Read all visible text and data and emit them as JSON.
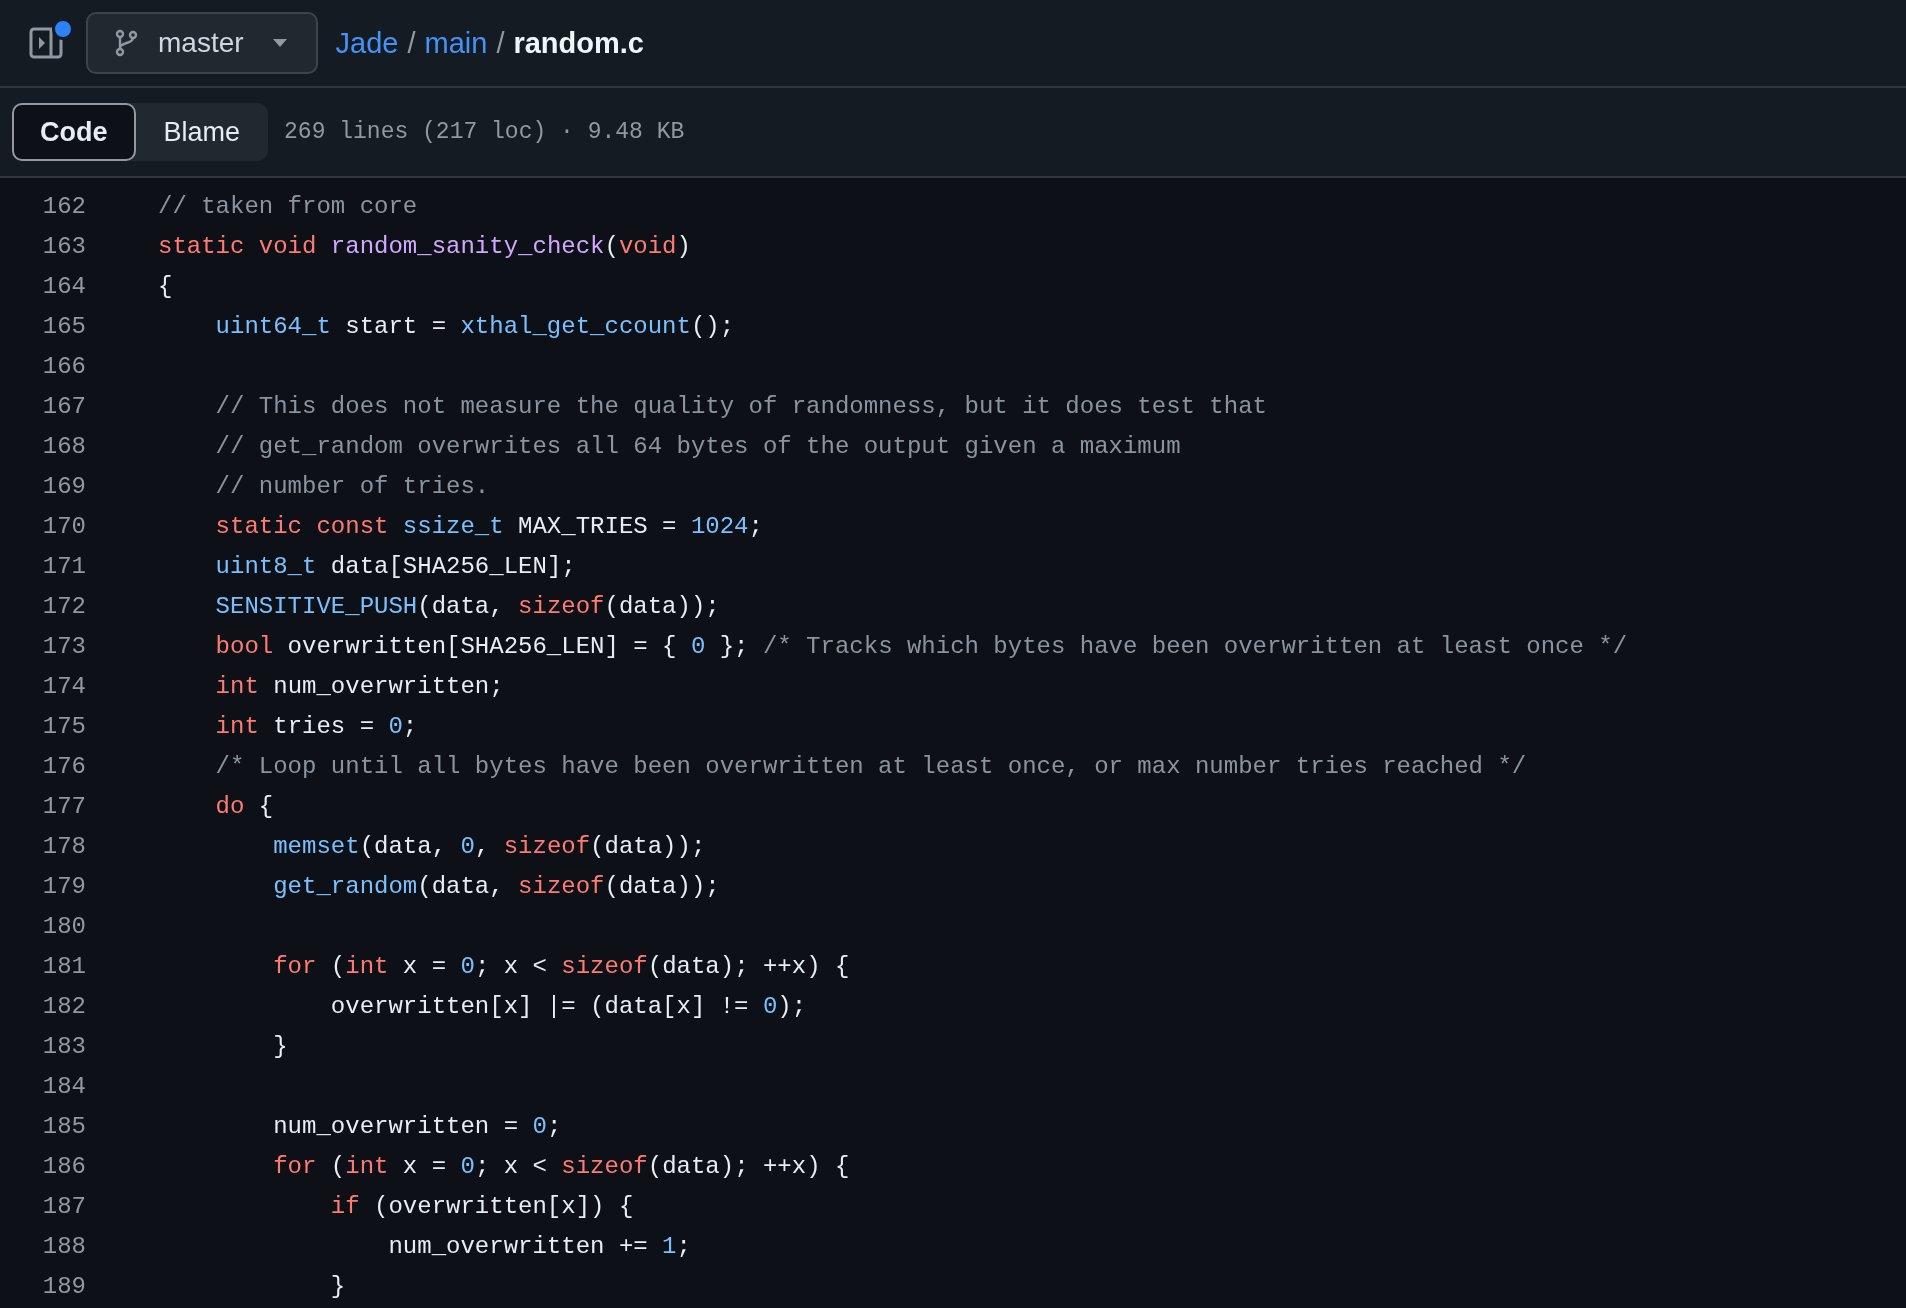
{
  "header": {
    "notification_dot": true,
    "branch": "master",
    "breadcrumb": [
      {
        "text": "Jade",
        "kind": "link"
      },
      {
        "text": "/",
        "kind": "sep"
      },
      {
        "text": "main",
        "kind": "link"
      },
      {
        "text": "/",
        "kind": "sep"
      },
      {
        "text": "random.c",
        "kind": "current"
      }
    ]
  },
  "tabs": [
    {
      "label": "Code",
      "selected": true
    },
    {
      "label": "Blame",
      "selected": false
    }
  ],
  "file_info": "269 lines (217 loc) · 9.48 KB",
  "lines": [
    {
      "number": "162",
      "tokens": [
        {
          "kind": "c",
          "text": "// taken from core"
        }
      ]
    },
    {
      "number": "163",
      "tokens": [
        {
          "kind": "k",
          "text": "static void"
        },
        {
          "kind": "f",
          "text": " random_sanity_check"
        },
        {
          "kind": "p",
          "text": "("
        },
        {
          "kind": "k",
          "text": "void"
        },
        {
          "kind": "p",
          "text": ")"
        }
      ]
    },
    {
      "number": "164",
      "tokens": [
        {
          "kind": "p",
          "text": "{"
        }
      ]
    },
    {
      "number": "165",
      "tokens": [
        {
          "kind": "t",
          "text": "    uint64_t"
        },
        {
          "kind": "p",
          "text": " start = "
        },
        {
          "kind": "t",
          "text": "xthal_get_ccount"
        },
        {
          "kind": "p",
          "text": "();"
        }
      ]
    },
    {
      "number": "166"
    },
    {
      "number": "167",
      "tokens": [
        {
          "kind": "c",
          "text": "    // This does not measure the quality of randomness, but it does test that"
        }
      ]
    },
    {
      "number": "168",
      "tokens": [
        {
          "kind": "c",
          "text": "    // get_random overwrites all 64 bytes of the output given a maximum"
        }
      ]
    },
    {
      "number": "169",
      "tokens": [
        {
          "kind": "c",
          "text": "    // number of tries."
        }
      ]
    },
    {
      "number": "170",
      "tokens": [
        {
          "kind": "k",
          "text": "    static const"
        },
        {
          "kind": "t",
          "text": " ssize_t"
        },
        {
          "kind": "p",
          "text": " MAX_TRIES = "
        },
        {
          "kind": "n",
          "text": "1024"
        },
        {
          "kind": "p",
          "text": ";"
        }
      ]
    },
    {
      "number": "171",
      "tokens": [
        {
          "kind": "t",
          "text": "    uint8_t"
        },
        {
          "kind": "p",
          "text": " data[SHA256_LEN];"
        }
      ]
    },
    {
      "number": "172",
      "tokens": [
        {
          "kind": "t",
          "text": "    SENSITIVE_PUSH"
        },
        {
          "kind": "p",
          "text": "(data, "
        },
        {
          "kind": "k",
          "text": "sizeof"
        },
        {
          "kind": "p",
          "text": "(data));"
        }
      ]
    },
    {
      "number": "173",
      "tokens": [
        {
          "kind": "k",
          "text": "    bool"
        },
        {
          "kind": "p",
          "text": " overwritten[SHA256_LEN] = { "
        },
        {
          "kind": "n",
          "text": "0"
        },
        {
          "kind": "p",
          "text": " }; "
        },
        {
          "kind": "c",
          "text": "/* Tracks which bytes have been overwritten at least once */"
        }
      ]
    },
    {
      "number": "174",
      "tokens": [
        {
          "kind": "k",
          "text": "    int"
        },
        {
          "kind": "p",
          "text": " num_overwritten;"
        }
      ]
    },
    {
      "number": "175",
      "tokens": [
        {
          "kind": "k",
          "text": "    int"
        },
        {
          "kind": "p",
          "text": " tries = "
        },
        {
          "kind": "n",
          "text": "0"
        },
        {
          "kind": "p",
          "text": ";"
        }
      ]
    },
    {
      "number": "176",
      "tokens": [
        {
          "kind": "c",
          "text": "    /* Loop until all bytes have been overwritten at least once, or max number tries reached */"
        }
      ]
    },
    {
      "number": "177",
      "tokens": [
        {
          "kind": "k",
          "text": "    do"
        },
        {
          "kind": "p",
          "text": " {"
        }
      ]
    },
    {
      "number": "178",
      "tokens": [
        {
          "kind": "t",
          "text": "        memset"
        },
        {
          "kind": "p",
          "text": "(data, "
        },
        {
          "kind": "n",
          "text": "0"
        },
        {
          "kind": "p",
          "text": ", "
        },
        {
          "kind": "k",
          "text": "sizeof"
        },
        {
          "kind": "p",
          "text": "(data));"
        }
      ]
    },
    {
      "number": "179",
      "tokens": [
        {
          "kind": "t",
          "text": "        get_random"
        },
        {
          "kind": "p",
          "text": "(data, "
        },
        {
          "kind": "k",
          "text": "sizeof"
        },
        {
          "kind": "p",
          "text": "(data));"
        }
      ]
    },
    {
      "number": "180"
    },
    {
      "number": "181",
      "tokens": [
        {
          "kind": "k",
          "text": "        for"
        },
        {
          "kind": "p",
          "text": " ("
        },
        {
          "kind": "k",
          "text": "int"
        },
        {
          "kind": "p",
          "text": " x = "
        },
        {
          "kind": "n",
          "text": "0"
        },
        {
          "kind": "p",
          "text": "; x < "
        },
        {
          "kind": "k",
          "text": "sizeof"
        },
        {
          "kind": "p",
          "text": "(data); ++x) {"
        }
      ]
    },
    {
      "number": "182",
      "tokens": [
        {
          "kind": "p",
          "text": "            overwritten[x] |= (data[x] != "
        },
        {
          "kind": "n",
          "text": "0"
        },
        {
          "kind": "p",
          "text": ");"
        }
      ]
    },
    {
      "number": "183",
      "tokens": [
        {
          "kind": "p",
          "text": "        }"
        }
      ]
    },
    {
      "number": "184"
    },
    {
      "number": "185",
      "tokens": [
        {
          "kind": "p",
          "text": "        num_overwritten = "
        },
        {
          "kind": "n",
          "text": "0"
        },
        {
          "kind": "p",
          "text": ";"
        }
      ]
    },
    {
      "number": "186",
      "tokens": [
        {
          "kind": "k",
          "text": "        for"
        },
        {
          "kind": "p",
          "text": " ("
        },
        {
          "kind": "k",
          "text": "int"
        },
        {
          "kind": "p",
          "text": " x = "
        },
        {
          "kind": "n",
          "text": "0"
        },
        {
          "kind": "p",
          "text": "; x < "
        },
        {
          "kind": "k",
          "text": "sizeof"
        },
        {
          "kind": "p",
          "text": "(data); ++x) {"
        }
      ]
    },
    {
      "number": "187",
      "tokens": [
        {
          "kind": "k",
          "text": "            if"
        },
        {
          "kind": "p",
          "text": " (overwritten[x]) {"
        }
      ]
    },
    {
      "number": "188",
      "tokens": [
        {
          "kind": "p",
          "text": "                num_overwritten += "
        },
        {
          "kind": "n",
          "text": "1"
        },
        {
          "kind": "p",
          "text": ";"
        }
      ]
    },
    {
      "number": "189",
      "tokens": [
        {
          "kind": "p",
          "text": "            }"
        }
      ]
    }
  ]
}
